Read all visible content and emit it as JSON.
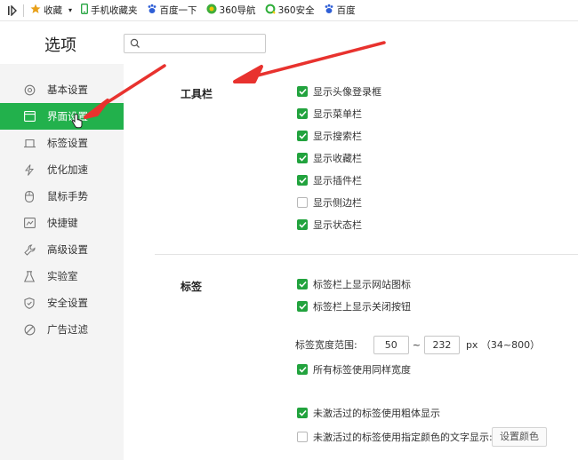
{
  "bookmarks_bar": {
    "items": [
      {
        "label": "收藏",
        "icon": "star-icon"
      },
      {
        "label": "手机收藏夹",
        "icon": "phone-icon"
      },
      {
        "label": "百度一下",
        "icon": "baidu-paw-icon"
      },
      {
        "label": "360导航",
        "icon": "360-logo-icon"
      },
      {
        "label": "360安全",
        "icon": "360-ring-icon"
      },
      {
        "label": "百度",
        "icon": "baidu-paw-icon"
      }
    ]
  },
  "header": {
    "title": "选项",
    "search_placeholder": ""
  },
  "sidebar": {
    "items": [
      {
        "label": "基本设置",
        "icon": "gear-icon",
        "active": false
      },
      {
        "label": "界面设置",
        "icon": "window-icon",
        "active": true
      },
      {
        "label": "标签设置",
        "icon": "tab-icon",
        "active": false
      },
      {
        "label": "优化加速",
        "icon": "lightning-icon",
        "active": false
      },
      {
        "label": "鼠标手势",
        "icon": "mouse-icon",
        "active": false
      },
      {
        "label": "快捷键",
        "icon": "keyboard-icon",
        "active": false
      },
      {
        "label": "高级设置",
        "icon": "wrench-icon",
        "active": false
      },
      {
        "label": "实验室",
        "icon": "flask-icon",
        "active": false
      },
      {
        "label": "安全设置",
        "icon": "shield-icon",
        "active": false
      },
      {
        "label": "广告过滤",
        "icon": "block-icon",
        "active": false
      }
    ]
  },
  "toolbar_section": {
    "title": "工具栏",
    "options": [
      {
        "label": "显示头像登录框",
        "checked": true
      },
      {
        "label": "显示菜单栏",
        "checked": true
      },
      {
        "label": "显示搜索栏",
        "checked": true
      },
      {
        "label": "显示收藏栏",
        "checked": true
      },
      {
        "label": "显示插件栏",
        "checked": true
      },
      {
        "label": "显示侧边栏",
        "checked": false
      },
      {
        "label": "显示状态栏",
        "checked": true
      }
    ]
  },
  "tabs_section": {
    "title": "标签",
    "options": [
      {
        "label": "标签栏上显示网站图标",
        "checked": true
      },
      {
        "label": "标签栏上显示关闭按钮",
        "checked": true
      }
    ],
    "width_range": {
      "label": "标签宽度范围:",
      "min": "50",
      "separator": "~",
      "max": "232",
      "unit": "px （34~800）"
    },
    "same_width": {
      "label": "所有标签使用同样宽度",
      "checked": true
    },
    "inactive_bold": {
      "label": "未激活过的标签使用粗体显示",
      "checked": true
    },
    "inactive_color": {
      "label": "未激活过的标签使用指定颜色的文字显示:",
      "checked": false
    },
    "set_color_button": "设置颜色"
  },
  "colors": {
    "accent": "#22b14c",
    "checkbox": "#22a33e",
    "annotation_arrow": "#e8322e"
  }
}
